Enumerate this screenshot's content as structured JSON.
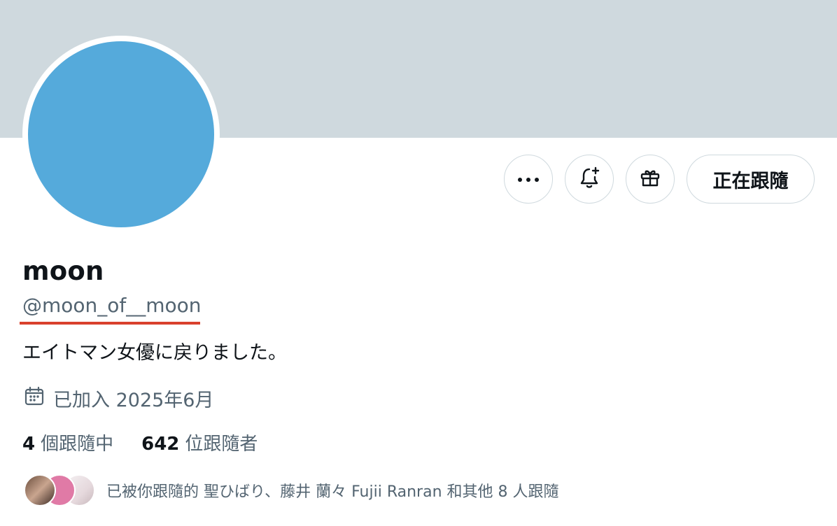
{
  "profile": {
    "name": "moon",
    "handle": "@moon_of__moon",
    "bio": "エイトマン女優に戻りました。",
    "joined": "已加入 2025年6月"
  },
  "actions": {
    "more_icon": "more-horizontal-icon",
    "notify_icon": "bell-plus-icon",
    "gift_icon": "gift-icon",
    "follow_label": "正在跟隨"
  },
  "stats": {
    "following_count": "4",
    "following_label": "個跟隨中",
    "followers_count": "642",
    "followers_label": "位跟隨者"
  },
  "followed_by": {
    "text": "已被你跟隨的 聖ひばり、藤井 蘭々 Fujii Ranran 和其他 8 人跟隨"
  },
  "colors": {
    "banner": "#cfd9de",
    "avatar": "#55aadb",
    "secondary_text": "#536471",
    "primary_text": "#0f1419",
    "annotation_underline": "#d9412d"
  }
}
